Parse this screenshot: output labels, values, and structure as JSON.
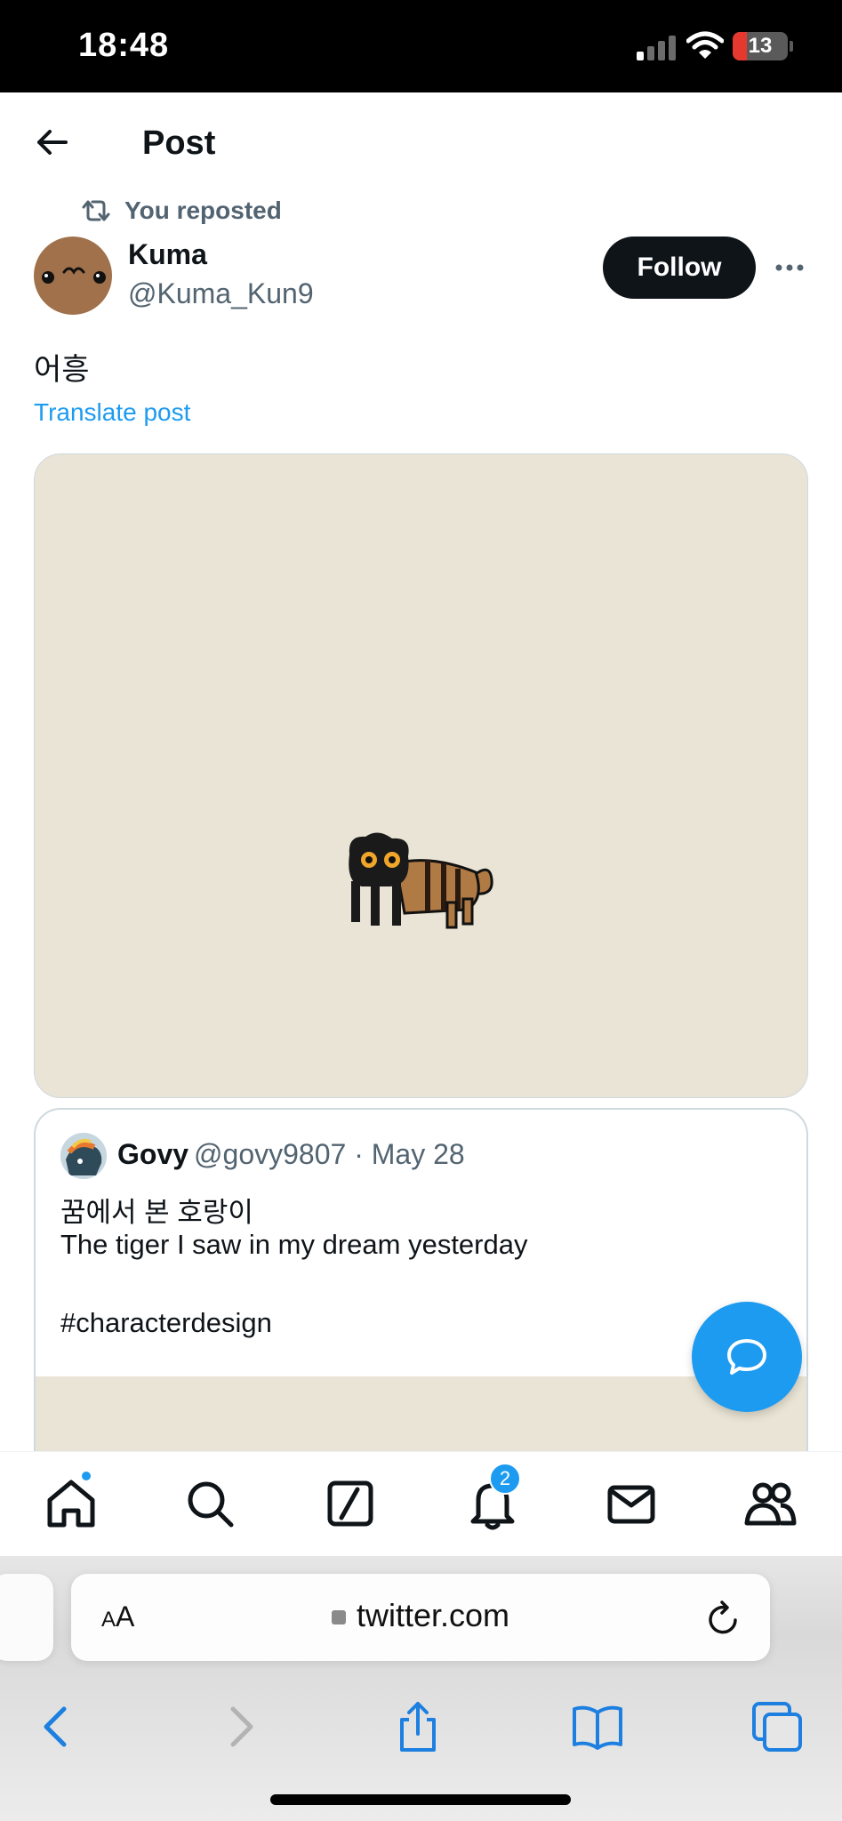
{
  "status_bar": {
    "time": "18:48",
    "battery": "13"
  },
  "header": {
    "title": "Post"
  },
  "repost": {
    "label": "You reposted"
  },
  "author": {
    "name": "Kuma",
    "handle": "@Kuma_Kun9",
    "follow_label": "Follow"
  },
  "post": {
    "text": "어흥",
    "translate_label": "Translate post"
  },
  "quote": {
    "name": "Govy",
    "meta": "@govy9807 · May 28",
    "lines": [
      "꿈에서 본 호랑이",
      "The tiger I saw in my dream yesterday",
      "",
      "#characterdesign"
    ]
  },
  "tabbar": {
    "notifications_badge": "2"
  },
  "browser": {
    "text_size_label_a": "A",
    "text_size_label_b": "A",
    "url": "twitter.com"
  },
  "colors": {
    "accent": "#1d9bf0",
    "text_primary": "#0f1419",
    "text_secondary": "#536471",
    "media_bg": "#e9e4d5"
  },
  "icons": [
    "back-arrow-icon",
    "repost-icon",
    "more-icon",
    "compose-message-icon",
    "home-icon",
    "search-icon",
    "compose-icon",
    "bell-icon",
    "mail-icon",
    "people-icon",
    "lock-icon",
    "reload-icon",
    "chevron-left-icon",
    "chevron-right-icon",
    "share-icon",
    "book-icon",
    "tabs-icon"
  ]
}
